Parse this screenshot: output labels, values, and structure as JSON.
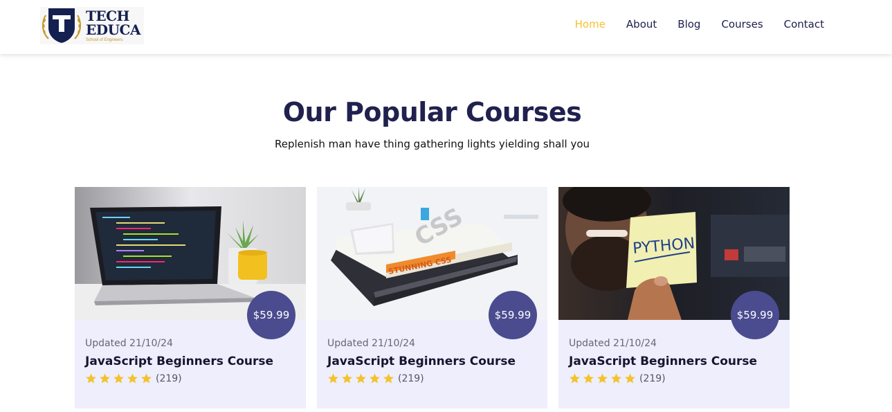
{
  "brand": {
    "logo_letter": "T",
    "line1": "TECH",
    "line2": "EDUCA",
    "tagline": "School of Engineers"
  },
  "nav": {
    "items": [
      {
        "label": "Home",
        "active": true
      },
      {
        "label": "About",
        "active": false
      },
      {
        "label": "Blog",
        "active": false
      },
      {
        "label": "Courses",
        "active": false
      },
      {
        "label": "Contact",
        "active": false
      }
    ]
  },
  "section": {
    "title": "Our Popular Courses",
    "subtitle": "Replenish man have thing gathering lights yielding shall you"
  },
  "courses": [
    {
      "image": "laptop-code-photo",
      "price": "$59.99",
      "updated": "Updated 21/10/24",
      "title": "JavaScript Beginners Course",
      "rating": 5,
      "reviews": "(219)"
    },
    {
      "image": "css-books-photo",
      "price": "$59.99",
      "updated": "Updated 21/10/24",
      "title": "JavaScript Beginners Course",
      "rating": 5,
      "reviews": "(219)"
    },
    {
      "image": "python-note-photo",
      "price": "$59.99",
      "updated": "Updated 21/10/24",
      "title": "JavaScript Beginners Course",
      "rating": 5,
      "reviews": "(219)"
    }
  ],
  "colors": {
    "accent": "#f4c22b",
    "brand_dark": "#20214f",
    "badge": "#4b4b8f",
    "card_bg": "#eeeefc",
    "star": "#f4c22b"
  }
}
